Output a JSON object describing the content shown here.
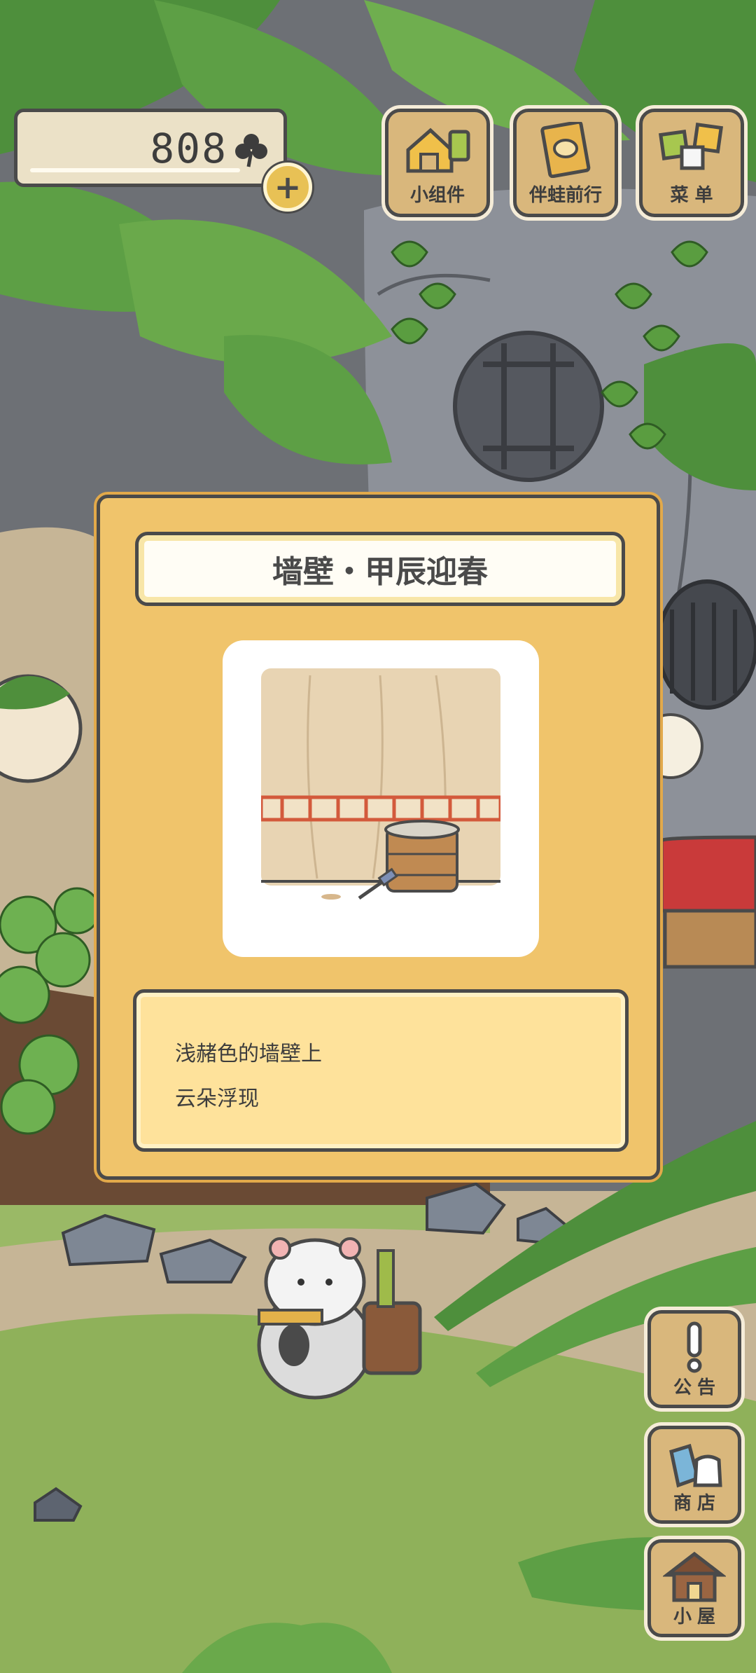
{
  "currency": {
    "amount": "808",
    "icon": "clover-icon",
    "add_icon": "plus-icon"
  },
  "top_buttons": [
    {
      "label": "小组件",
      "icon": "widget-icon"
    },
    {
      "label": "伴蛙前行",
      "icon": "journey-book-icon"
    },
    {
      "label": "菜 单",
      "icon": "menu-cards-icon"
    }
  ],
  "side_buttons": [
    {
      "label": "公告",
      "icon": "exclamation-icon"
    },
    {
      "label": "商店",
      "icon": "shop-bags-icon"
    },
    {
      "label": "小屋",
      "icon": "house-icon"
    }
  ],
  "item_card": {
    "title": "墙壁・甲辰迎春",
    "image": "wall-bucket-brush-illustration",
    "description": [
      "浅赭色的墙壁上",
      "云朵浮现"
    ]
  },
  "colors": {
    "card_bg": "#f0c46b",
    "desc_bg": "#fee29b",
    "button_wood": "#d9b77c",
    "outline": "#4a4a4a"
  }
}
